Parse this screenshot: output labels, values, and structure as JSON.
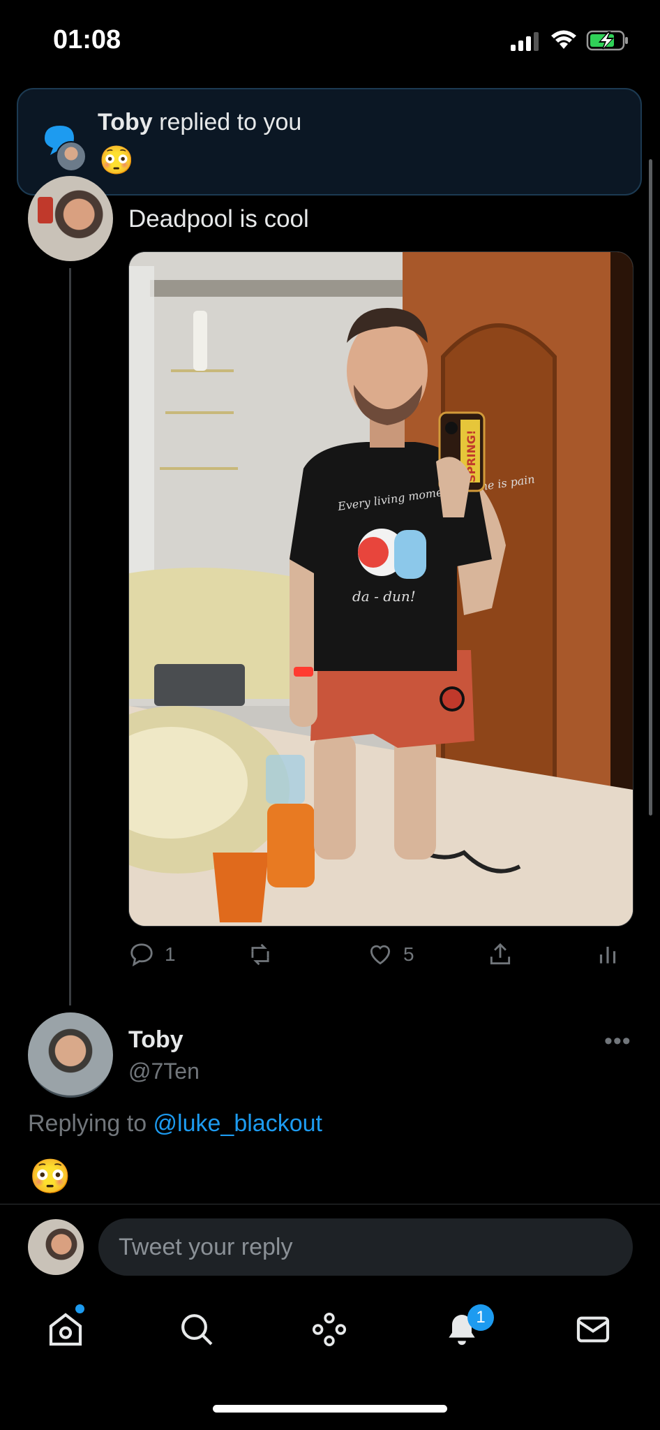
{
  "status_bar": {
    "time": "01:08"
  },
  "banner": {
    "name": "Toby",
    "message": " replied to you",
    "emoji": "😳"
  },
  "tweet": {
    "text": "Deadpool is cool",
    "shirt_text": "Every living moment for me is pain",
    "shirt_text2": "da - dun!",
    "phone_case_text": "SPRING!",
    "actions": {
      "reply_count": "1",
      "retweet_count": "",
      "like_count": "5"
    }
  },
  "reply": {
    "name": "Toby",
    "handle": "@7Ten",
    "more": "•••",
    "replying_prefix": "Replying to ",
    "replying_to": "@luke_blackout",
    "emoji": "😳"
  },
  "composer": {
    "placeholder": "Tweet your reply"
  },
  "tabbar": {
    "notifications_badge": "1",
    "items": [
      "home-icon",
      "search-icon",
      "spaces-icon",
      "notifications-icon",
      "messages-icon"
    ]
  },
  "colors": {
    "accent": "#1d9bf0",
    "background": "#000000",
    "muted": "#71767b",
    "banner_bg": "#0b1724"
  }
}
